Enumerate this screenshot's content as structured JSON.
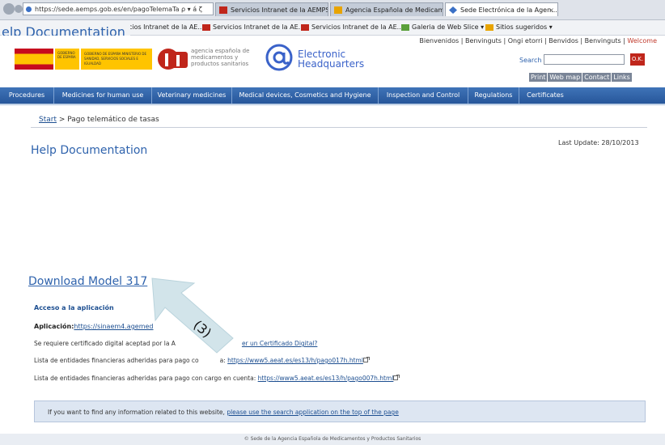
{
  "browser": {
    "url": "https://sede.aemps.gob.es/en/pagoTelemaTa ρ ▾ á ζ",
    "tabs": [
      {
        "label": "Servicios Intranet de la AEMPS",
        "active": false
      },
      {
        "label": "Agencia Española de Medicam...",
        "active": false
      },
      {
        "label": "Sede Electrónica de la Agen...",
        "active": true
      }
    ],
    "tab_close": "×",
    "favorites": [
      "vicios Intranet de la AE...",
      "Servicios Intranet de la AE...",
      "Servicios Intranet de la AE...",
      "Galeria de Web Slice ▾",
      "Sitios sugeridos ▾"
    ]
  },
  "overlay_help": "elp Documentation",
  "header": {
    "welcome_prefix": "Bienvenidos | Benvinguts | Ongi etorri | Benvidos | Benvinguts | ",
    "welcome_highlight": "Welcome",
    "ministry_text": "GOBIERNO DE ESPAÑA  MINISTERIO DE SANIDAD, SERVICIOS SOCIALES E IGUALDAD",
    "gov_text": "GOBIERNO DE ESPAÑA",
    "aemps_text_1": "agencia española de",
    "aemps_text_2": "medicamentos y",
    "aemps_text_3": "productos sanitarios",
    "eh_line1": "Electronic",
    "eh_line2": "Headquarters",
    "search_label": "Search",
    "ok_label": "O.K.",
    "util_links": [
      "Print",
      "Web map",
      "Contact",
      "Links"
    ]
  },
  "nav": [
    "Procedures",
    "Medicines for human use",
    "Veterinary medicines",
    "Medical devices, Cosmetics and Hygiene",
    "Inspection and Control",
    "Regulations",
    "Certificates"
  ],
  "breadcrumb": {
    "start": "Start",
    "separator": " > ",
    "current": "Pago telemático de tasas"
  },
  "page_title": "Help Documentation",
  "last_update": "Last Update: 28/10/2013",
  "download_link": "Download Model 317",
  "access": {
    "heading": "Acceso a la aplicación",
    "app_label": "Aplicación:",
    "app_link": "https://sinaem4.agemed",
    "cert_text": "Se requiere certificado digital aceptad  por la A",
    "cert_link": "er un Certificado Digital?",
    "list1_text": "Lista de entidades financieras adheridas para pago co",
    "list1_mid": "a: ",
    "list1_link": "https://www5.aeat.es/es13/h/pago017h.html",
    "list2_text": "Lista de entidades financieras adheridas para pago con cargo en cuenta: ",
    "list2_link": "https://www5.aeat.es/es13/h/pago007h.html"
  },
  "info_box": {
    "text": "If you want to find any information related to this website, ",
    "link": "please use the search application on the top of the page"
  },
  "annotation_number": "(3)",
  "footer": "© Sede de la Agencia Española de Medicamentos y Productos Sanitarios",
  "colors": {
    "nav_bg": "#3064ad",
    "link": "#2f63ad",
    "welcome_highlight": "#c0392b",
    "ok_button": "#c0261b",
    "info_box": "#dde6f2",
    "arrow": "#d2e4ea"
  }
}
